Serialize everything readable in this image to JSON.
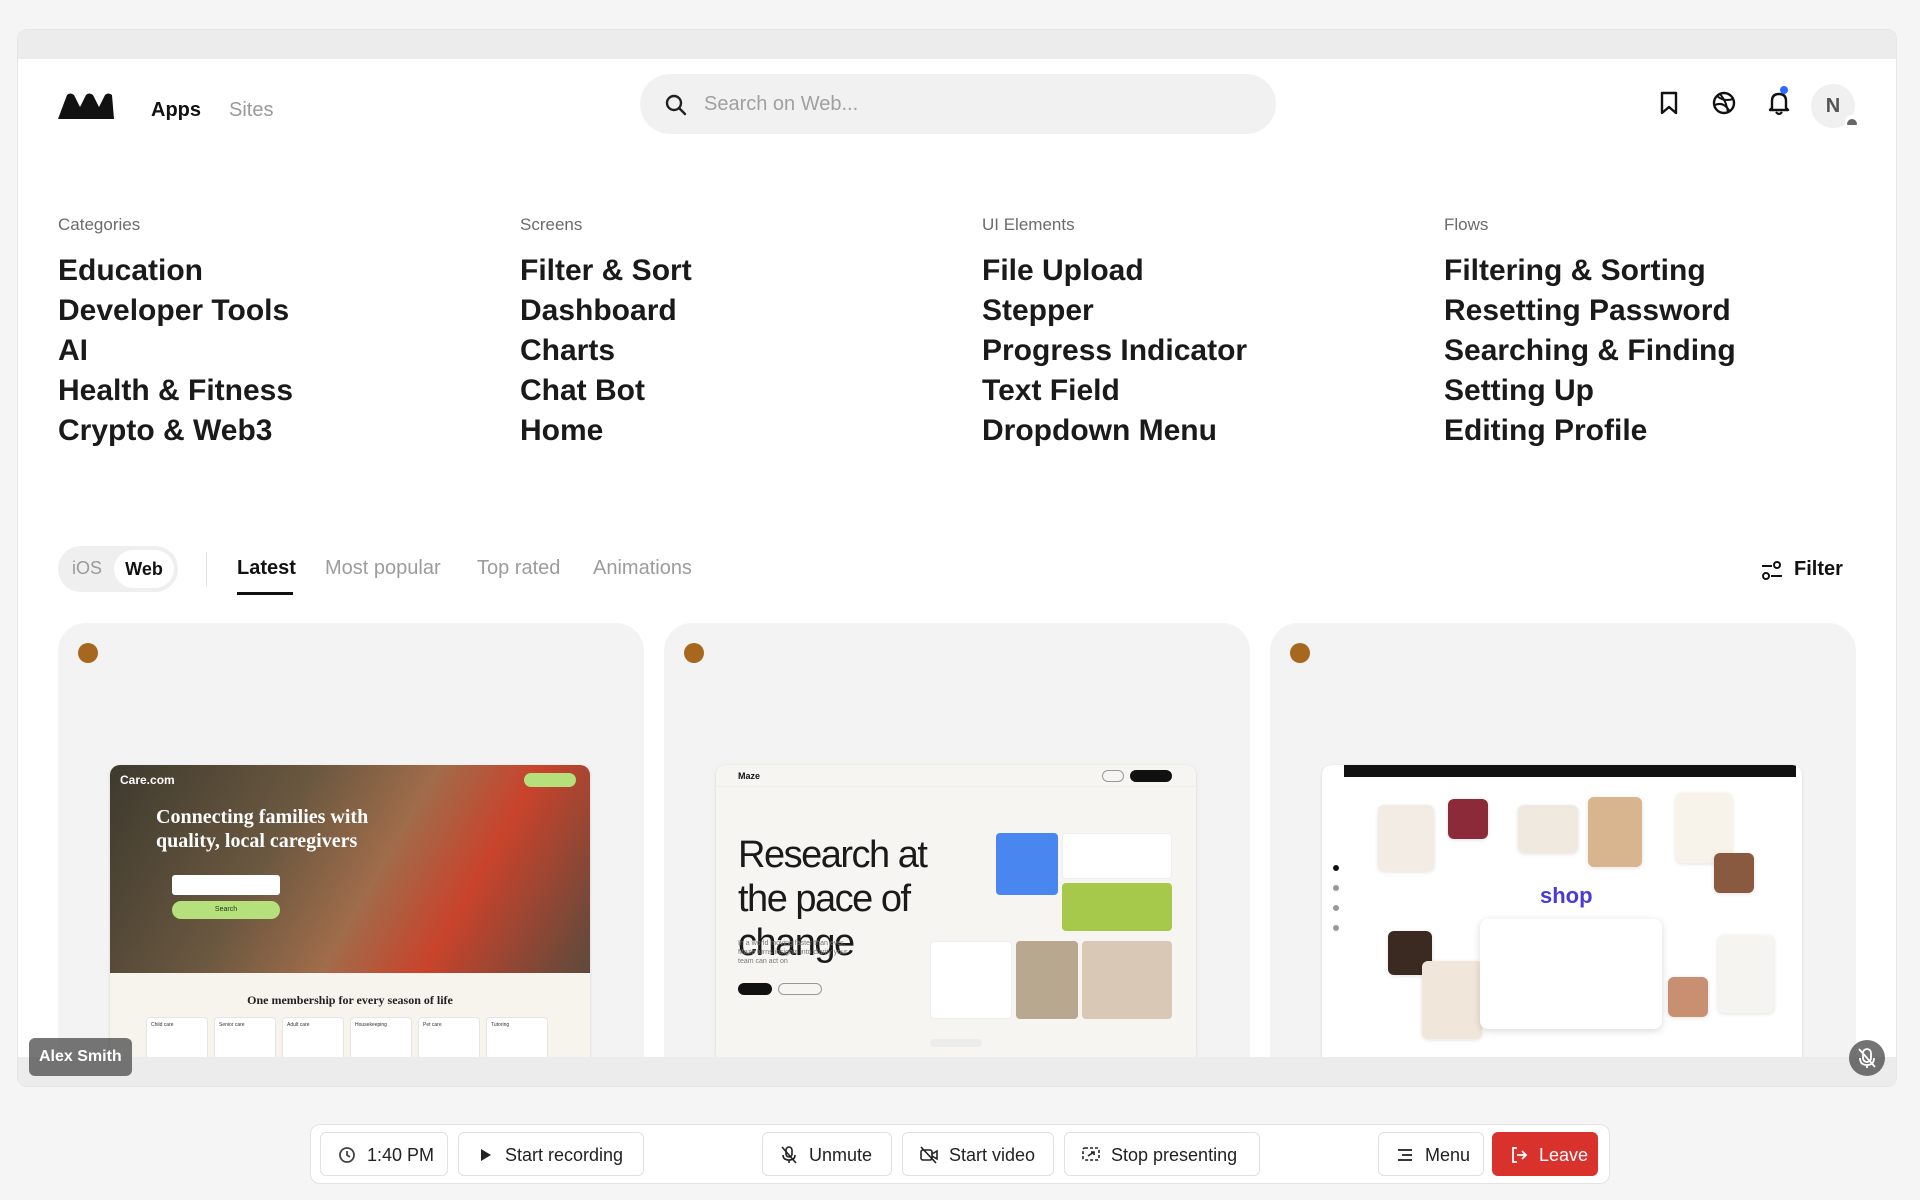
{
  "header": {
    "nav_tabs": [
      "Apps",
      "Sites"
    ],
    "search_placeholder": "Search on Web...",
    "avatar_initial": "N"
  },
  "categories": [
    {
      "heading": "Categories",
      "items": [
        "Education",
        "Developer Tools",
        "AI",
        "Health & Fitness",
        "Crypto & Web3"
      ]
    },
    {
      "heading": "Screens",
      "items": [
        "Filter & Sort",
        "Dashboard",
        "Charts",
        "Chat Bot",
        "Home"
      ]
    },
    {
      "heading": "UI Elements",
      "items": [
        "File Upload",
        "Stepper",
        "Progress Indicator",
        "Text Field",
        "Dropdown Menu"
      ]
    },
    {
      "heading": "Flows",
      "items": [
        "Filtering & Sorting",
        "Resetting Password",
        "Searching & Finding",
        "Setting Up",
        "Editing Profile"
      ]
    }
  ],
  "platform_toggle": {
    "options": [
      "iOS",
      "Web"
    ],
    "selected": "Web"
  },
  "feed_tabs": {
    "items": [
      "Latest",
      "Most popular",
      "Top rated",
      "Animations"
    ],
    "active": "Latest"
  },
  "filter_label": "Filter",
  "cards": [
    {
      "logo": "Care.com",
      "headline": "Connecting families with quality, local caregivers",
      "search_button": "Search",
      "subheadline": "One membership for every season of life",
      "tiles": [
        "Child care",
        "Senior care",
        "Adult care",
        "Housekeeping",
        "Pet care",
        "Tutoring"
      ]
    },
    {
      "logo": "Maze",
      "headline": "Research at the pace of change",
      "body": "In a world moving faster than ever, Maze turns insights into clarity your team can act on"
    },
    {
      "brand": "shop"
    }
  ],
  "participant_name": "Alex Smith",
  "toolbar": {
    "time": "1:40 PM",
    "start_recording": "Start recording",
    "unmute": "Unmute",
    "start_video": "Start video",
    "stop_presenting": "Stop presenting",
    "menu": "Menu",
    "leave": "Leave"
  },
  "colors": {
    "accent_dot": "#a8671f",
    "leave_red": "#d9322d",
    "notification_blue": "#2a6cf5",
    "shop_purple": "#4a3ad6"
  },
  "icons": [
    "logo-icon",
    "search-icon",
    "bookmark-icon",
    "dribbble-icon",
    "bell-icon",
    "filter-icon",
    "clock-icon",
    "record-icon",
    "mic-off-icon",
    "video-off-icon",
    "screen-share-icon",
    "menu-icon",
    "leave-icon"
  ]
}
